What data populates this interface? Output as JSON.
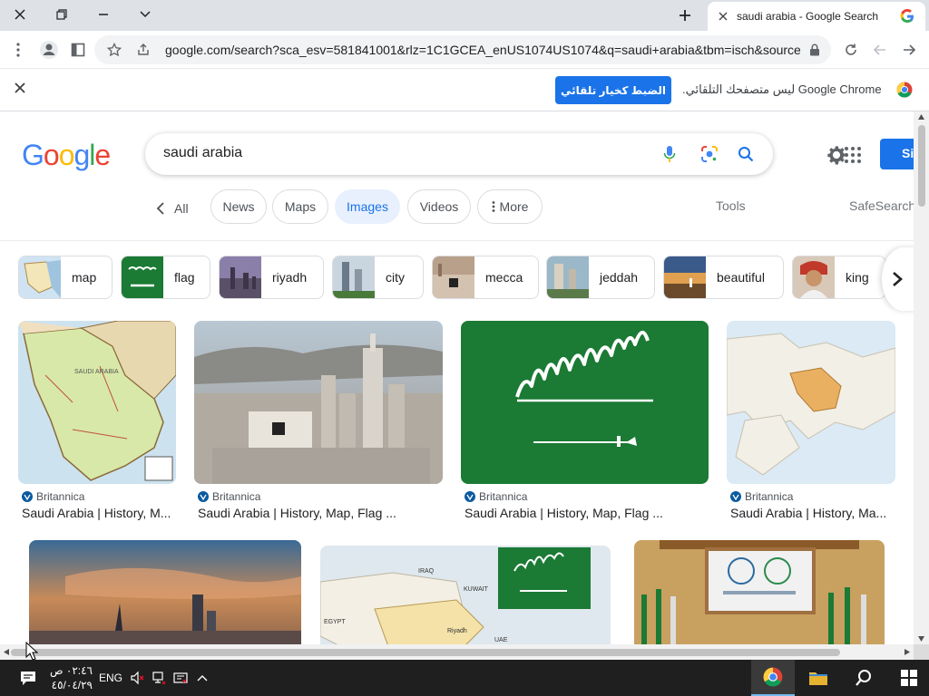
{
  "browser": {
    "tab_title": "saudi arabia - Google Search",
    "url": "google.com/search?sca_esv=581841001&rlz=1C1GCEA_enUS1074US1074&q=saudi+arabia&tbm=isch&source..."
  },
  "infobar": {
    "message": "Google Chrome ليس متصفحك التلقائي.",
    "button_label": "الضبط كخيار تلقائي"
  },
  "search": {
    "logo": "Google",
    "query": "saudi arabia",
    "signin_label": "Si"
  },
  "tabs": {
    "all": "All",
    "items": [
      "News",
      "Maps",
      "Images",
      "Videos",
      "More"
    ],
    "active": "Images",
    "tools": "Tools",
    "safesearch": "SafeSearch"
  },
  "chips": [
    {
      "label": "map"
    },
    {
      "label": "flag"
    },
    {
      "label": "riyadh"
    },
    {
      "label": "city"
    },
    {
      "label": "mecca"
    },
    {
      "label": "jeddah"
    },
    {
      "label": "beautiful"
    },
    {
      "label": "king"
    }
  ],
  "results": [
    {
      "source": "Britannica",
      "title": "Saudi Arabia | History, M..."
    },
    {
      "source": "Britannica",
      "title": "Saudi Arabia | History, Map, Flag ..."
    },
    {
      "source": "Britannica",
      "title": "Saudi Arabia | History, Map, Flag ..."
    },
    {
      "source": "Britannica",
      "title": "Saudi Arabia | History, Ma..."
    }
  ],
  "image_labels": {
    "map_sa": "SAUDI ARABIA",
    "iraq": "IRAQ",
    "kuwait": "KUWAIT",
    "egypt": "EGYPT",
    "uae": "UAE",
    "riyadh": "Riyadh"
  },
  "taskbar": {
    "language": "ENG",
    "time": "٠٢:٤٦ ص",
    "date": "٤٥/٠٤/٢٩"
  },
  "colors": {
    "accent": "#1a73e8",
    "flag_green": "#1b7a34",
    "taskbar": "#1f1f1f"
  }
}
